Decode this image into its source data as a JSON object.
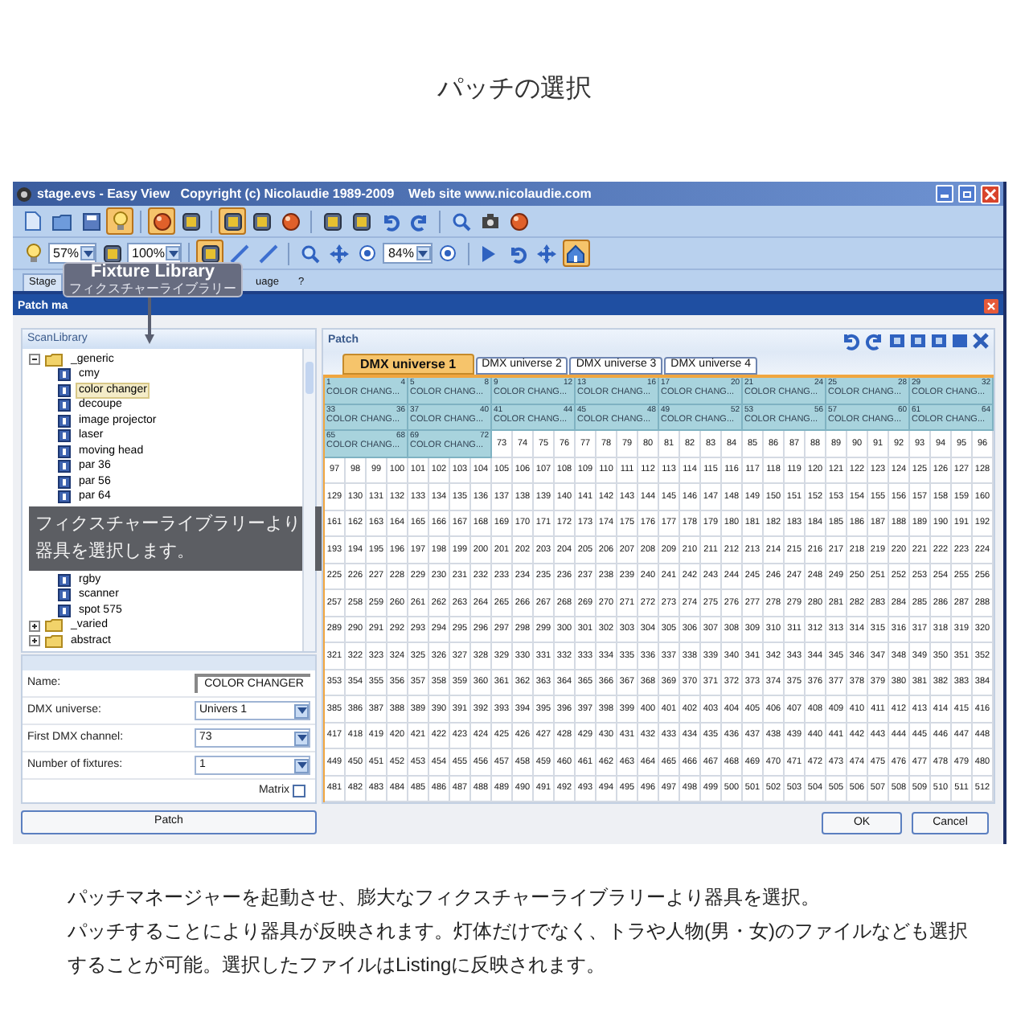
{
  "heading": "パッチの選択",
  "window": {
    "title": "stage.evs - Easy View   Copyright (c) Nicolaudie 1989-2009    Web site www.nicolaudie.com"
  },
  "toolbar_1": [
    {
      "kind": "doc",
      "pressed": false
    },
    {
      "kind": "folder",
      "pressed": false
    },
    {
      "kind": "floppy",
      "pressed": false
    },
    {
      "kind": "bulb",
      "pressed": true
    },
    {
      "kind": "sep"
    },
    {
      "kind": "ball",
      "pressed": true
    },
    {
      "kind": "square",
      "pressed": false
    },
    {
      "kind": "sep"
    },
    {
      "kind": "square",
      "pressed": true
    },
    {
      "kind": "square",
      "pressed": false
    },
    {
      "kind": "ball",
      "pressed": false
    },
    {
      "kind": "sep"
    },
    {
      "kind": "square",
      "pressed": false
    },
    {
      "kind": "square",
      "pressed": false
    },
    {
      "kind": "undo",
      "pressed": false
    },
    {
      "kind": "redo",
      "pressed": false
    },
    {
      "kind": "sep"
    },
    {
      "kind": "magnifier",
      "pressed": false
    },
    {
      "kind": "camera",
      "pressed": false
    },
    {
      "kind": "ball",
      "pressed": false
    }
  ],
  "toolbar_2": [
    {
      "kind": "bulb",
      "pressed": false
    },
    {
      "kind": "combo",
      "value": "57%"
    },
    {
      "kind": "square",
      "pressed": false
    },
    {
      "kind": "combo",
      "value": "100%"
    },
    {
      "kind": "sep"
    },
    {
      "kind": "square",
      "pressed": true
    },
    {
      "kind": "line",
      "pressed": false
    },
    {
      "kind": "line",
      "pressed": false
    },
    {
      "kind": "sep"
    },
    {
      "kind": "magnifier",
      "pressed": false
    },
    {
      "kind": "move",
      "pressed": false
    },
    {
      "kind": "target",
      "pressed": false
    },
    {
      "kind": "combo",
      "value": "84%"
    },
    {
      "kind": "target",
      "pressed": false
    },
    {
      "kind": "sep"
    },
    {
      "kind": "cursor",
      "pressed": false
    },
    {
      "kind": "undo",
      "pressed": false
    },
    {
      "kind": "move",
      "pressed": false
    },
    {
      "kind": "home",
      "pressed": true
    }
  ],
  "menu": [
    {
      "label": "Stage",
      "selected": true
    },
    {
      "label": "uage",
      "selected": false
    },
    {
      "label": "?",
      "selected": false
    }
  ],
  "tooltip": {
    "title": "Fixture Library",
    "subtitle": "フィクスチャーライブラリー"
  },
  "dialog": {
    "title": "Patch ma"
  },
  "library": {
    "title": "ScanLibrary",
    "tree": [
      {
        "label": "_generic",
        "expanded": true,
        "children": [
          {
            "label": "cmy",
            "selected": false
          },
          {
            "label": "color changer",
            "selected": true
          },
          {
            "label": "decoupe",
            "selected": false
          },
          {
            "label": "image projector",
            "selected": false
          },
          {
            "label": "laser",
            "selected": false
          },
          {
            "label": "moving head",
            "selected": false
          },
          {
            "label": "par 36",
            "selected": false
          },
          {
            "label": "par 56",
            "selected": false
          },
          {
            "label": "par 64",
            "selected": false
          },
          {
            "label": "rgby",
            "selected": false
          },
          {
            "label": "scanner",
            "selected": false
          },
          {
            "label": "spot 575",
            "selected": false
          }
        ]
      },
      {
        "label": "_varied",
        "expanded": false
      },
      {
        "label": "abstract",
        "expanded": false
      }
    ]
  },
  "callout": "フィクスチャーライブラリーより器具を選択します。",
  "form": {
    "name_label": "Name:",
    "name_value": "COLOR CHANGER",
    "universe_label": "DMX universe:",
    "universe_value": "Univers 1",
    "channel_label": "First DMX channel:",
    "channel_value": "73",
    "count_label": "Number of fixtures:",
    "count_value": "1",
    "matrix_label": "Matrix",
    "matrix_checked": false
  },
  "patch_button": "Patch",
  "patch": {
    "title": "Patch",
    "tabs": [
      {
        "label": "DMX universe 1",
        "selected": true
      },
      {
        "label": "DMX universe 2",
        "selected": false
      },
      {
        "label": "DMX universe 3",
        "selected": false
      },
      {
        "label": "DMX universe 4",
        "selected": false
      }
    ],
    "fixtures": [
      {
        "start": "1",
        "end": "4",
        "label": "COLOR CHANG..."
      },
      {
        "start": "5",
        "end": "8",
        "label": "COLOR CHANG..."
      },
      {
        "start": "9",
        "end": "12",
        "label": "COLOR CHANG..."
      },
      {
        "start": "13",
        "end": "16",
        "label": "COLOR CHANG..."
      },
      {
        "start": "17",
        "end": "20",
        "label": "COLOR CHANG..."
      },
      {
        "start": "21",
        "end": "24",
        "label": "COLOR CHANG..."
      },
      {
        "start": "25",
        "end": "28",
        "label": "COLOR CHANG..."
      },
      {
        "start": "29",
        "end": "32",
        "label": "COLOR CHANG..."
      },
      {
        "start": "33",
        "end": "36",
        "label": "COLOR CHANG..."
      },
      {
        "start": "37",
        "end": "40",
        "label": "COLOR CHANG..."
      },
      {
        "start": "41",
        "end": "44",
        "label": "COLOR CHANG..."
      },
      {
        "start": "45",
        "end": "48",
        "label": "COLOR CHANG..."
      },
      {
        "start": "49",
        "end": "52",
        "label": "COLOR CHANG..."
      },
      {
        "start": "53",
        "end": "56",
        "label": "COLOR CHANG..."
      },
      {
        "start": "57",
        "end": "60",
        "label": "COLOR CHANG..."
      },
      {
        "start": "61",
        "end": "64",
        "label": "COLOR CHANG..."
      },
      {
        "start": "65",
        "end": "68",
        "label": "COLOR CHANG..."
      },
      {
        "start": "69",
        "end": "72",
        "label": "COLOR CHANG..."
      }
    ],
    "channels": [
      "73",
      "74",
      "75",
      "76",
      "77",
      "78",
      "79",
      "80",
      "81",
      "82",
      "83",
      "84",
      "85",
      "86",
      "87",
      "88",
      "89",
      "90",
      "91",
      "92",
      "93",
      "94",
      "95",
      "96",
      "97",
      "98",
      "99",
      "100",
      "101",
      "102",
      "103",
      "104",
      "105",
      "106",
      "107",
      "108",
      "109",
      "110",
      "111",
      "112",
      "113",
      "114",
      "115",
      "116",
      "117",
      "118",
      "119",
      "120",
      "121",
      "122",
      "123",
      "124",
      "125",
      "126",
      "127",
      "128",
      "129",
      "130",
      "131",
      "132",
      "133",
      "134",
      "135",
      "136",
      "137",
      "138",
      "139",
      "140",
      "141",
      "142",
      "143",
      "144",
      "145",
      "146",
      "147",
      "148",
      "149",
      "150",
      "151",
      "152",
      "153",
      "154",
      "155",
      "156",
      "157",
      "158",
      "159",
      "160",
      "161",
      "162",
      "163",
      "164",
      "165",
      "166",
      "167",
      "168",
      "169",
      "170",
      "171",
      "172",
      "173",
      "174",
      "175",
      "176",
      "177",
      "178",
      "179",
      "180",
      "181",
      "182",
      "183",
      "184",
      "185",
      "186",
      "187",
      "188",
      "189",
      "190",
      "191",
      "192",
      "193",
      "194",
      "195",
      "196",
      "197",
      "198",
      "199",
      "200",
      "201",
      "202",
      "203",
      "204",
      "205",
      "206",
      "207",
      "208",
      "209",
      "210",
      "211",
      "212",
      "213",
      "214",
      "215",
      "216",
      "217",
      "218",
      "219",
      "220",
      "221",
      "222",
      "223",
      "224",
      "225",
      "226",
      "227",
      "228",
      "229",
      "230",
      "231",
      "232",
      "233",
      "234",
      "235",
      "236",
      "237",
      "238",
      "239",
      "240",
      "241",
      "242",
      "243",
      "244",
      "245",
      "246",
      "247",
      "248",
      "249",
      "250",
      "251",
      "252",
      "253",
      "254",
      "255",
      "256",
      "257",
      "258",
      "259",
      "260",
      "261",
      "262",
      "263",
      "264",
      "265",
      "266",
      "267",
      "268",
      "269",
      "270",
      "271",
      "272",
      "273",
      "274",
      "275",
      "276",
      "277",
      "278",
      "279",
      "280",
      "281",
      "282",
      "283",
      "284",
      "285",
      "286",
      "287",
      "288",
      "289",
      "290",
      "291",
      "292",
      "293",
      "294",
      "295",
      "296",
      "297",
      "298",
      "299",
      "300",
      "301",
      "302",
      "303",
      "304",
      "305",
      "306",
      "307",
      "308",
      "309",
      "310",
      "311",
      "312",
      "313",
      "314",
      "315",
      "316",
      "317",
      "318",
      "319",
      "320",
      "321",
      "322",
      "323",
      "324",
      "325",
      "326",
      "327",
      "328",
      "329",
      "330",
      "331",
      "332",
      "333",
      "334",
      "335",
      "336",
      "337",
      "338",
      "339",
      "340",
      "341",
      "342",
      "343",
      "344",
      "345",
      "346",
      "347",
      "348",
      "349",
      "350",
      "351",
      "352",
      "353",
      "354",
      "355",
      "356",
      "357",
      "358",
      "359",
      "360",
      "361",
      "362",
      "363",
      "364",
      "365",
      "366",
      "367",
      "368",
      "369",
      "370",
      "371",
      "372",
      "373",
      "374",
      "375",
      "376",
      "377",
      "378",
      "379",
      "380",
      "381",
      "382",
      "383",
      "384",
      "385",
      "386",
      "387",
      "388",
      "389",
      "390",
      "391",
      "392",
      "393",
      "394",
      "395",
      "396",
      "397",
      "398",
      "399",
      "400",
      "401",
      "402",
      "403",
      "404",
      "405",
      "406",
      "407",
      "408",
      "409",
      "410",
      "411",
      "412",
      "413",
      "414",
      "415",
      "416",
      "417",
      "418",
      "419",
      "420",
      "421",
      "422",
      "423",
      "424",
      "425",
      "426",
      "427",
      "428",
      "429",
      "430",
      "431",
      "432",
      "433",
      "434",
      "435",
      "436",
      "437",
      "438",
      "439",
      "440",
      "441",
      "442",
      "443",
      "444",
      "445",
      "446",
      "447",
      "448",
      "449",
      "450",
      "451",
      "452",
      "453",
      "454",
      "455",
      "456",
      "457",
      "458",
      "459",
      "460",
      "461",
      "462",
      "463",
      "464",
      "465",
      "466",
      "467",
      "468",
      "469",
      "470",
      "471",
      "472",
      "473",
      "474",
      "475",
      "476",
      "477",
      "478",
      "479",
      "480",
      "481",
      "482",
      "483",
      "484",
      "485",
      "486",
      "487",
      "488",
      "489",
      "490",
      "491",
      "492",
      "493",
      "494",
      "495",
      "496",
      "497",
      "498",
      "499",
      "500",
      "501",
      "502",
      "503",
      "504",
      "505",
      "506",
      "507",
      "508",
      "509",
      "510",
      "511",
      "512"
    ]
  },
  "ok_button": "OK",
  "cancel_button": "Cancel",
  "description": [
    "パッチマネージャーを起動させ、膨大なフィクスチャーライブラリーより器具を選択。",
    "パッチすることにより器具が反映されます。灯体だけでなく、トラや人物(男・女)のファイルなども選択",
    "することが可能。選択したファイルはListingに反映されます。"
  ]
}
